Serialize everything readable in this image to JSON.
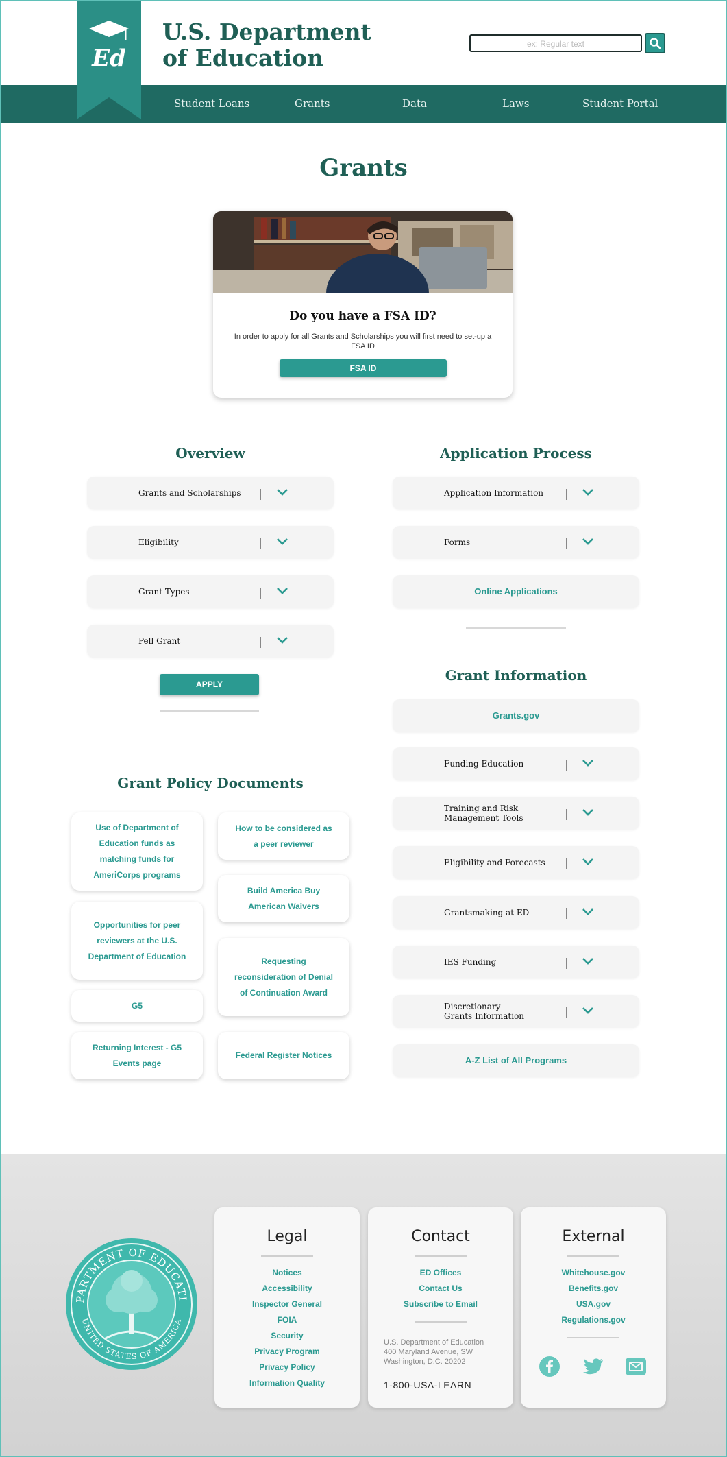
{
  "header": {
    "title_line1": "U.S. Department",
    "title_line2": "of Education",
    "logo_text": "Ed",
    "search": {
      "placeholder": "ex: Regular text"
    }
  },
  "nav": {
    "items": [
      {
        "label": "Student Loans"
      },
      {
        "label": "Grants"
      },
      {
        "label": "Data"
      },
      {
        "label": "Laws"
      },
      {
        "label": "Student Portal"
      }
    ]
  },
  "page": {
    "title": "Grants"
  },
  "fsa_card": {
    "heading": "Do you have a FSA ID?",
    "text": "In order to apply for all Grants and Scholarships you will first need to set-up a FSA ID",
    "button_label": "FSA ID"
  },
  "overview": {
    "title": "Overview",
    "items": [
      {
        "label": "Grants and Scholarships"
      },
      {
        "label": "Eligibility"
      },
      {
        "label": "Grant Types"
      },
      {
        "label": "Pell Grant"
      }
    ],
    "apply_label": "APPLY"
  },
  "application_process": {
    "title": "Application Process",
    "items": [
      {
        "label": "Application Information"
      },
      {
        "label": "Forms"
      }
    ],
    "link_label": "Online Applications"
  },
  "grant_information": {
    "title": "Grant Information",
    "link_top": "Grants.gov",
    "items": [
      {
        "label": "Funding Education"
      },
      {
        "label": "Training and Risk Management Tools"
      },
      {
        "label": "Eligibility and Forecasts"
      },
      {
        "label": "Grantsmaking at ED"
      },
      {
        "label": "IES Funding"
      },
      {
        "label": "Discretionary Grants Information"
      }
    ],
    "link_bottom": "A-Z List of All Programs"
  },
  "policy_docs": {
    "title": "Grant Policy Documents",
    "left": [
      {
        "label": "Use of Department of Education funds as matching funds for AmeriCorps programs"
      },
      {
        "label": "Opportunities for peer reviewers at the U.S. Department of Education"
      },
      {
        "label": "G5"
      },
      {
        "label": "Returning Interest - G5 Events page"
      }
    ],
    "right": [
      {
        "label": "How to be considered as a peer reviewer"
      },
      {
        "label": "Build America Buy American Waivers"
      },
      {
        "label": "Requesting reconsideration of Denial of Continuation Award"
      },
      {
        "label": "Federal Register Notices"
      }
    ]
  },
  "footer": {
    "legal": {
      "title": "Legal",
      "links": [
        "Notices",
        "Accessibility",
        "Inspector General",
        "FOIA",
        "Security",
        "Privacy Program",
        "Privacy Policy",
        "Information Quality"
      ]
    },
    "contact": {
      "title": "Contact",
      "links": [
        "ED Offices",
        "Contact Us",
        "Subscribe to Email"
      ],
      "address_line1": "U.S. Department of Education",
      "address_line2": "400 Maryland Avenue, SW",
      "address_line3": "Washington, D.C. 20202",
      "phone": "1-800-USA-LEARN"
    },
    "external": {
      "title": "External",
      "links": [
        "Whitehouse.gov",
        "Benefits.gov",
        "USA.gov",
        "Regulations.gov"
      ],
      "social": [
        "facebook-icon",
        "twitter-icon",
        "email-icon"
      ]
    },
    "seal_text_top": "DEPARTMENT OF EDUCATION",
    "seal_text_bottom": "UNITED STATES OF AMERICA"
  },
  "colors": {
    "brand_dark": "#1f5f55",
    "nav_bg": "#1f6a62",
    "accent": "#2b9a91",
    "footer_bg": "#d9d9d9"
  }
}
